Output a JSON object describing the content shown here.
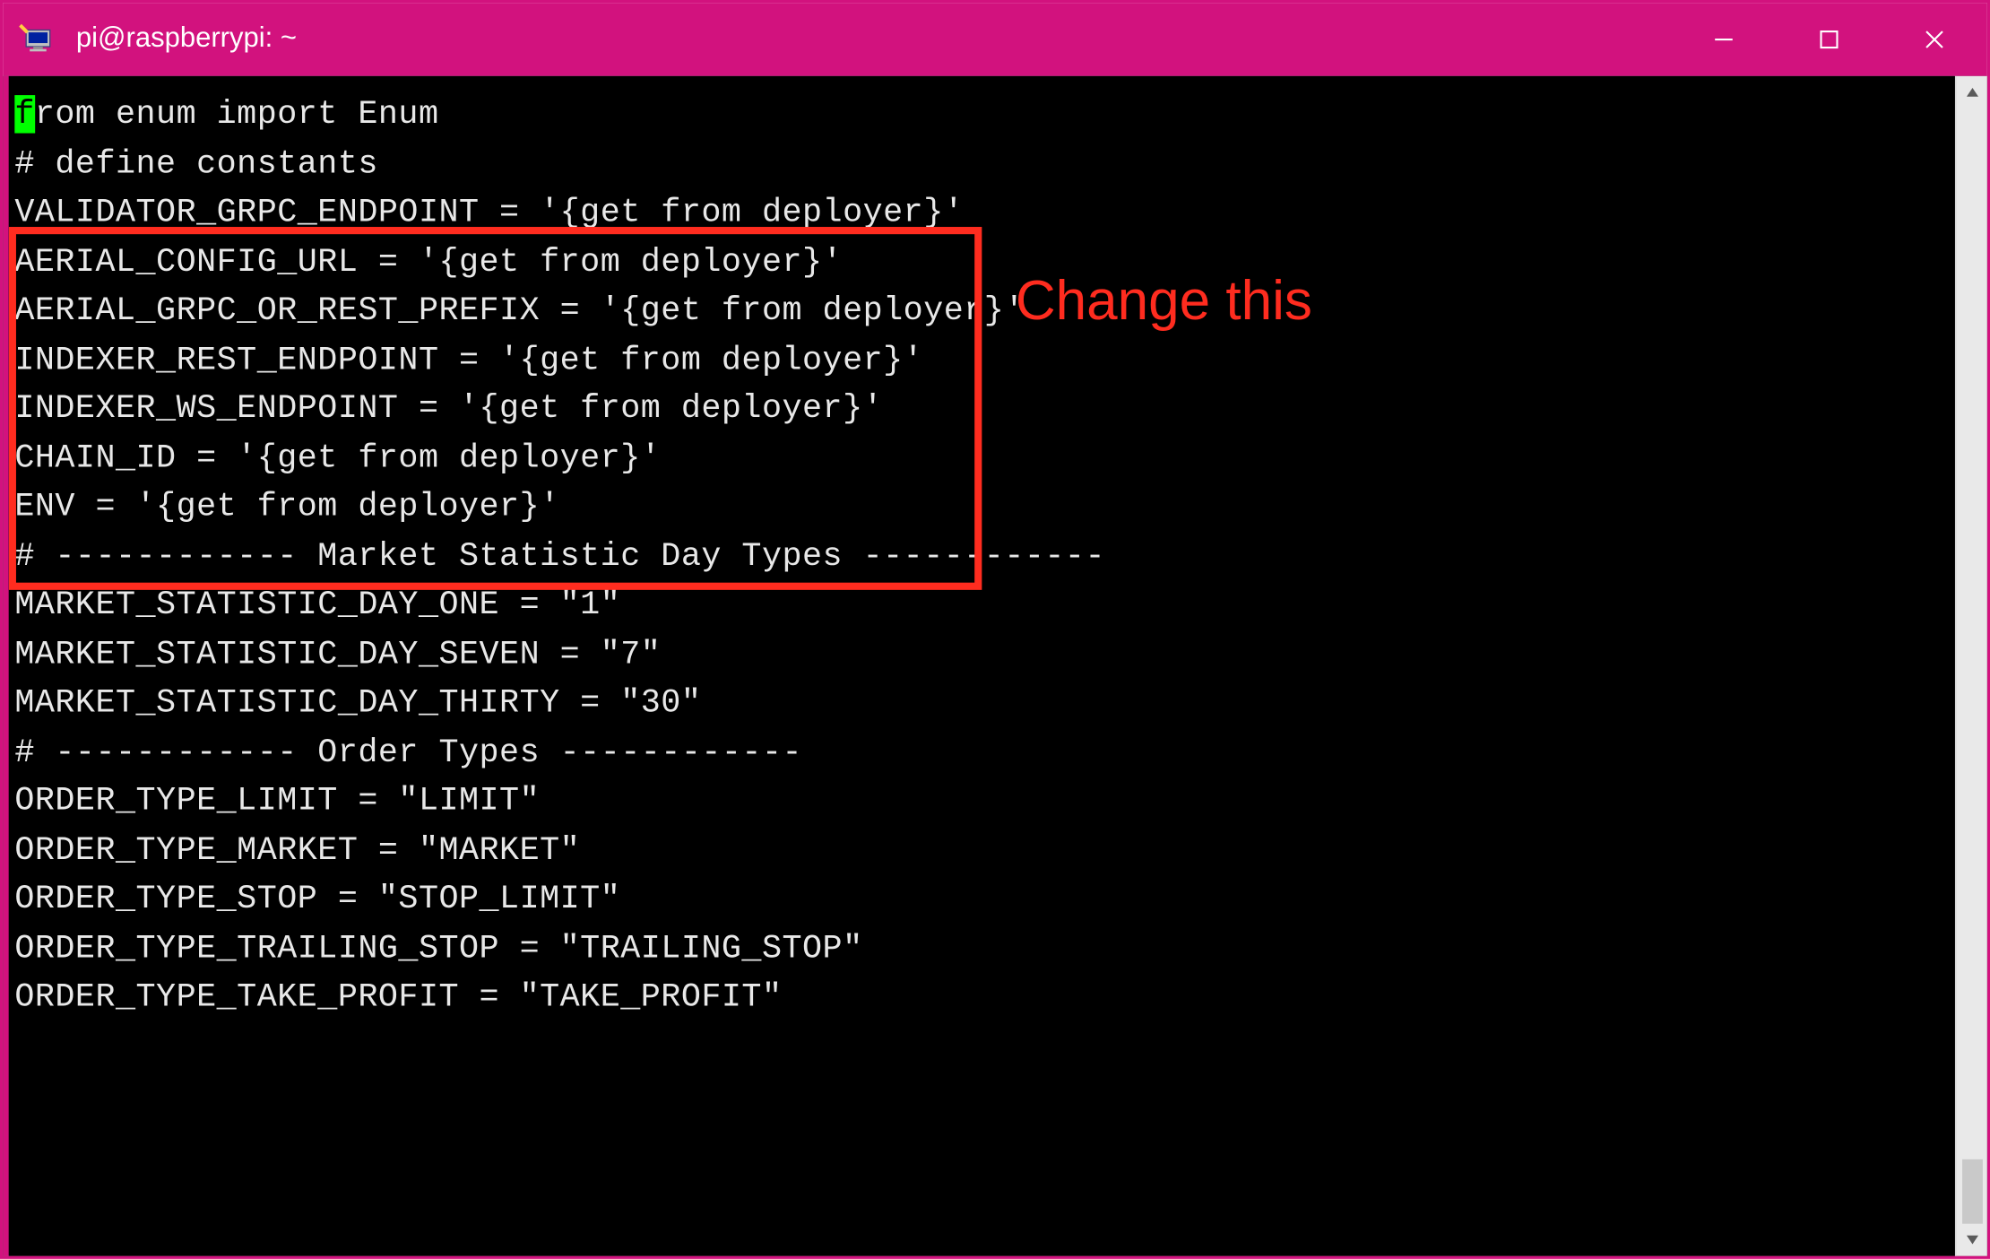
{
  "window": {
    "title": "pi@raspberrypi: ~"
  },
  "annotation": {
    "label": "Change this"
  },
  "code": {
    "cursor_char": "f",
    "line1_rest": "rom enum import Enum",
    "line2": "",
    "line3": "# define constants",
    "line4": "VALIDATOR_GRPC_ENDPOINT = '{get from deployer}'",
    "line5": "AERIAL_CONFIG_URL = '{get from deployer}'",
    "line6": "AERIAL_GRPC_OR_REST_PREFIX = '{get from deployer}'",
    "line7": "INDEXER_REST_ENDPOINT = '{get from deployer}'",
    "line8": "INDEXER_WS_ENDPOINT = '{get from deployer}'",
    "line9": "CHAIN_ID = '{get from deployer}'",
    "line10": "ENV = '{get from deployer}'",
    "line11": "",
    "line12": "# ------------ Market Statistic Day Types ------------",
    "line13": "MARKET_STATISTIC_DAY_ONE = \"1\"",
    "line14": "MARKET_STATISTIC_DAY_SEVEN = \"7\"",
    "line15": "MARKET_STATISTIC_DAY_THIRTY = \"30\"",
    "line16": "",
    "line17": "# ------------ Order Types ------------",
    "line18": "ORDER_TYPE_LIMIT = \"LIMIT\"",
    "line19": "ORDER_TYPE_MARKET = \"MARKET\"",
    "line20": "ORDER_TYPE_STOP = \"STOP_LIMIT\"",
    "line21": "ORDER_TYPE_TRAILING_STOP = \"TRAILING_STOP\"",
    "line22": "ORDER_TYPE_TAKE_PROFIT = \"TAKE_PROFIT\""
  }
}
